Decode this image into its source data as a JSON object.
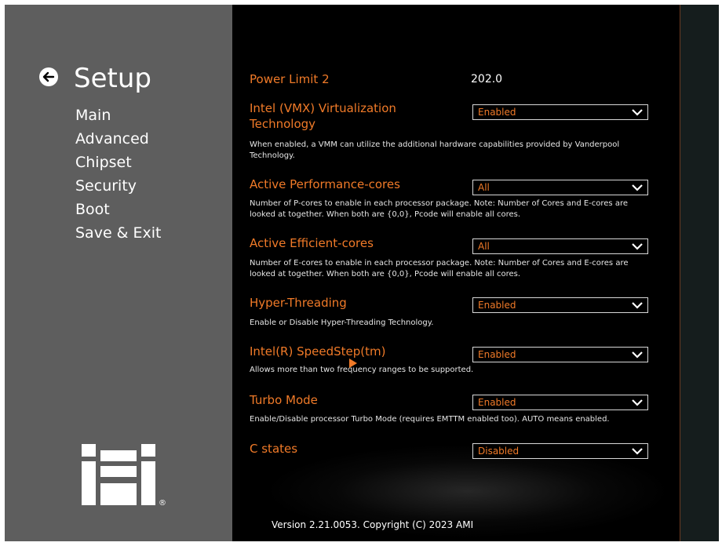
{
  "sidebar": {
    "title": "Setup",
    "items": [
      "Main",
      "Advanced",
      "Chipset",
      "Security",
      "Boot",
      "Save & Exit"
    ]
  },
  "logo": {
    "text": "iEi",
    "registered": "®"
  },
  "settings": [
    {
      "label": "Power Limit 2",
      "value": "202.0"
    },
    {
      "label_line1": "Intel (VMX) Virtualization",
      "label_line2": "Technology",
      "value": "Enabled",
      "desc_line1": "When enabled, a VMM can utilize the additional hardware capabilities provided by Vanderpool",
      "desc_line2": "Technology."
    },
    {
      "label": "Active Performance-cores",
      "value": "All",
      "desc_line1": "Number of P-cores to enable in each processor package. Note: Number of Cores and E-cores are",
      "desc_line2": "looked at together. When both are {0,0}, Pcode will enable all cores."
    },
    {
      "label": "Active Efficient-cores",
      "value": "All",
      "desc_line1": "Number of E-cores to enable in each processor package. Note: Number of Cores and E-cores are",
      "desc_line2": "looked at together. When both are {0,0}, Pcode will enable all cores."
    },
    {
      "label": "Hyper-Threading",
      "value": "Enabled",
      "desc_line1": "Enable or Disable Hyper-Threading Technology."
    },
    {
      "label": "Intel(R) SpeedStep(tm)",
      "value": "Enabled",
      "desc_line1": "Allows more than two frequency ranges to be supported."
    },
    {
      "label": "Turbo Mode",
      "value": "Enabled",
      "desc_line1": "Enable/Disable processor Turbo Mode (requires EMTTM enabled too). AUTO means enabled."
    },
    {
      "label": "C states",
      "value": "Disabled"
    }
  ],
  "footer": {
    "version": "Version 2.21.0053. Copyright (C) 2023 AMI"
  },
  "colors": {
    "accent": "#f07a28",
    "sidebar_bg": "#5e5e5e",
    "main_bg": "#000000"
  },
  "icons": {
    "back": "arrow-left-circle-icon",
    "dropdown": "chevron-down-icon",
    "pointer": "mouse-cursor-icon"
  }
}
